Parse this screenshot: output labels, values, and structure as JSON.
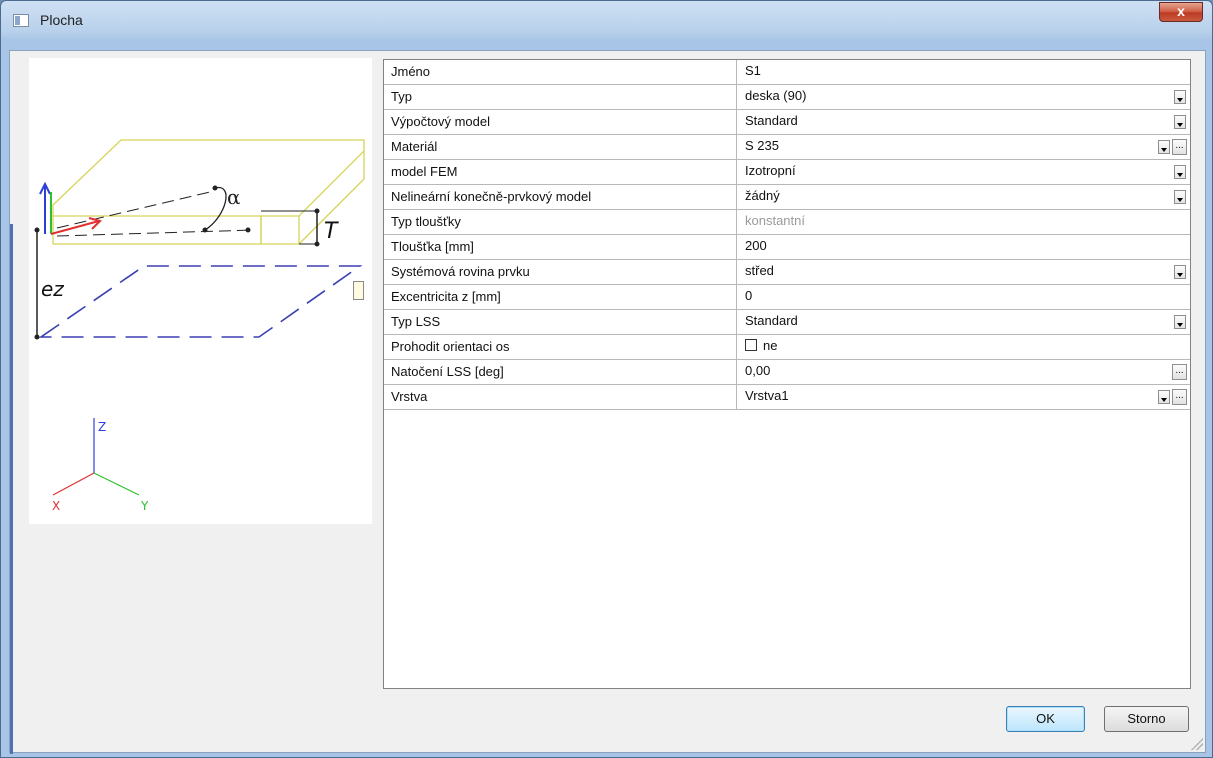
{
  "window": {
    "title": "Plocha",
    "close_glyph": "x"
  },
  "diagram": {
    "alpha_label": "α",
    "thickness_label": "T",
    "eccentricity_label": "ez",
    "axes": {
      "x": "X",
      "y": "Y",
      "z": "Z"
    },
    "colors": {
      "slab": "#d6d45a",
      "plane": "#3a3fb0",
      "x_axis": "#e03030",
      "y_axis": "#2ec02e",
      "z_axis": "#2d3fd6"
    }
  },
  "properties": [
    {
      "name": "Jméno",
      "value": "S1",
      "control": "text"
    },
    {
      "name": "Typ",
      "value": "deska (90)",
      "control": "dropdown"
    },
    {
      "name": "Výpočtový model",
      "value": "Standard",
      "control": "dropdown"
    },
    {
      "name": "Materiál",
      "value": "S 235",
      "control": "dropdown-ellipsis"
    },
    {
      "name": "model FEM",
      "value": "Izotropní",
      "control": "dropdown"
    },
    {
      "name": "Nelineární konečně-prvkový model",
      "value": "žádný",
      "control": "dropdown"
    },
    {
      "name": "Typ tloušťky",
      "value": "konstantní",
      "control": "readonly"
    },
    {
      "name": "Tloušťka [mm]",
      "value": "200",
      "control": "text"
    },
    {
      "name": "Systémová rovina prvku",
      "value": "střed",
      "control": "dropdown"
    },
    {
      "name": "Excentricita z [mm]",
      "value": "0",
      "control": "text"
    },
    {
      "name": "Typ LSS",
      "value": "Standard",
      "control": "dropdown"
    },
    {
      "name": "Prohodit orientaci os",
      "value": "ne",
      "control": "checkbox"
    },
    {
      "name": "Natočení LSS [deg]",
      "value": "0,00",
      "control": "ellipsis"
    },
    {
      "name": "Vrstva",
      "value": "Vrstva1",
      "control": "dropdown-ellipsis"
    }
  ],
  "buttons": {
    "ok": "OK",
    "cancel": "Storno"
  },
  "ellipsis_glyph": "..."
}
